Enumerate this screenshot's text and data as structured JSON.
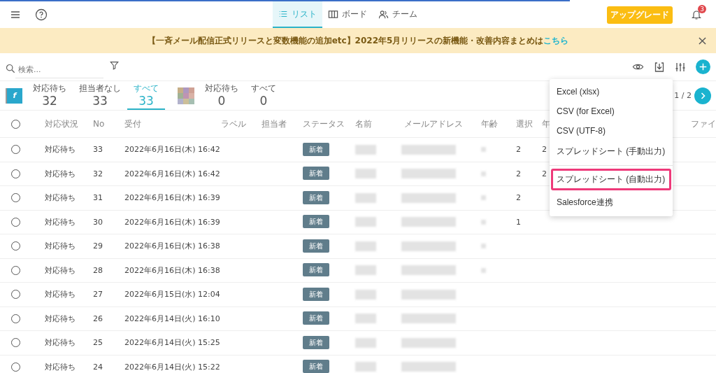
{
  "header": {
    "views": [
      {
        "label": "リスト",
        "selected": true
      },
      {
        "label": "ボード",
        "selected": false
      },
      {
        "label": "チーム",
        "selected": false
      }
    ],
    "upgrade": "アップグレード",
    "notifications": "3"
  },
  "banner": {
    "text": "【一斉メール配信正式リリースと変数機能の追加etc】2022年5月リリースの新機能・改善内容まとめは",
    "link": "こちら"
  },
  "search": {
    "placeholder": "検索..."
  },
  "forms": [
    {
      "logo_text": "f",
      "stats": [
        {
          "label": "対応待ち",
          "count": "32",
          "selected": false
        },
        {
          "label": "担当者なし",
          "count": "33",
          "selected": false
        },
        {
          "label": "すべて",
          "count": "33",
          "selected": true
        }
      ]
    },
    {
      "stats": [
        {
          "label": "対応待ち",
          "count": "0",
          "selected": false
        },
        {
          "label": "すべて",
          "count": "0",
          "selected": false
        }
      ]
    }
  ],
  "pagination": "1 / 2",
  "table": {
    "all_checked": false,
    "columns": [
      "対応状況",
      "No",
      "受付",
      "ラベル",
      "担当者",
      "ステータス",
      "名前",
      "メールアドレス",
      "年齢",
      "選択",
      "年",
      "ファイ"
    ],
    "rows": [
      {
        "checked": false,
        "state": "対応待ち",
        "no": "33",
        "date": "2022年6月16日(木) 16:42",
        "status": "新着",
        "choice": "2",
        "year": "2",
        "age_redacted": true
      },
      {
        "checked": false,
        "state": "対応待ち",
        "no": "32",
        "date": "2022年6月16日(木) 16:42",
        "status": "新着",
        "choice": "2",
        "year": "2",
        "age_redacted": true
      },
      {
        "checked": false,
        "state": "対応待ち",
        "no": "31",
        "date": "2022年6月16日(木) 16:39",
        "status": "新着",
        "choice": "2",
        "age_redacted": true
      },
      {
        "checked": false,
        "state": "対応待ち",
        "no": "30",
        "date": "2022年6月16日(木) 16:39",
        "status": "新着",
        "choice": "1",
        "age_redacted": true
      },
      {
        "checked": false,
        "state": "対応待ち",
        "no": "29",
        "date": "2022年6月16日(木) 16:38",
        "status": "新着",
        "age_redacted": true
      },
      {
        "checked": false,
        "state": "対応待ち",
        "no": "28",
        "date": "2022年6月16日(木) 16:38",
        "status": "新着",
        "age_redacted": true
      },
      {
        "checked": false,
        "state": "対応待ち",
        "no": "27",
        "date": "2022年6月15日(水) 12:04",
        "status": "新着",
        "age_redacted": false
      },
      {
        "checked": false,
        "state": "対応待ち",
        "no": "26",
        "date": "2022年6月14日(火) 16:10",
        "status": "新着",
        "age_redacted": false
      },
      {
        "checked": false,
        "state": "対応待ち",
        "no": "25",
        "date": "2022年6月14日(火) 15:25",
        "status": "新着",
        "age_redacted": false
      },
      {
        "checked": false,
        "state": "対応待ち",
        "no": "24",
        "date": "2022年6月14日(火) 15:22",
        "status": "新着",
        "age_redacted": false
      }
    ]
  },
  "export_menu": {
    "groups": [
      [
        {
          "label": "Excel (xlsx)",
          "selected": false
        },
        {
          "label": "CSV (for Excel)",
          "selected": false
        },
        {
          "label": "CSV (UTF-8)",
          "selected": false
        },
        {
          "label": "スプレッドシート (手動出力)",
          "selected": false
        }
      ],
      [
        {
          "label": "スプレッドシート (自動出力)",
          "selected": true
        },
        {
          "label": "Salesforce連携",
          "selected": false
        }
      ]
    ]
  }
}
